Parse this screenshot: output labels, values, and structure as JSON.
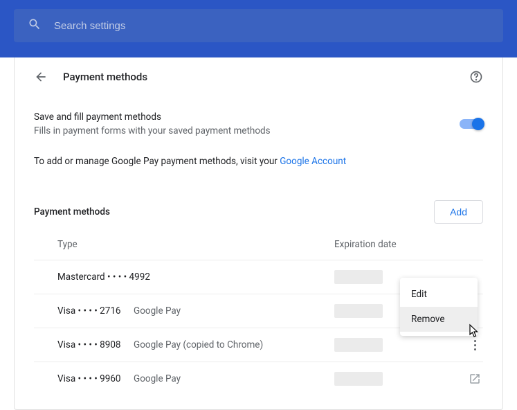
{
  "search": {
    "placeholder": "Search settings"
  },
  "page": {
    "title": "Payment methods"
  },
  "saveFill": {
    "title": "Save and fill payment methods",
    "desc": "Fills in payment forms with your saved payment methods",
    "enabled": true
  },
  "manage": {
    "prefix": "To add or manage Google Pay payment methods, visit your ",
    "linkText": "Google Account"
  },
  "section": {
    "title": "Payment methods",
    "addLabel": "Add",
    "colType": "Type",
    "colExp": "Expiration date"
  },
  "cards": [
    {
      "type": "Mastercard  • • • • 4992",
      "sub": ""
    },
    {
      "type": "Visa • • • • 2716",
      "sub": "Google Pay"
    },
    {
      "type": "Visa • • • • 8908",
      "sub": "Google Pay (copied to Chrome)"
    },
    {
      "type": "Visa • • • • 9960",
      "sub": "Google Pay"
    }
  ],
  "menu": {
    "edit": "Edit",
    "remove": "Remove"
  }
}
